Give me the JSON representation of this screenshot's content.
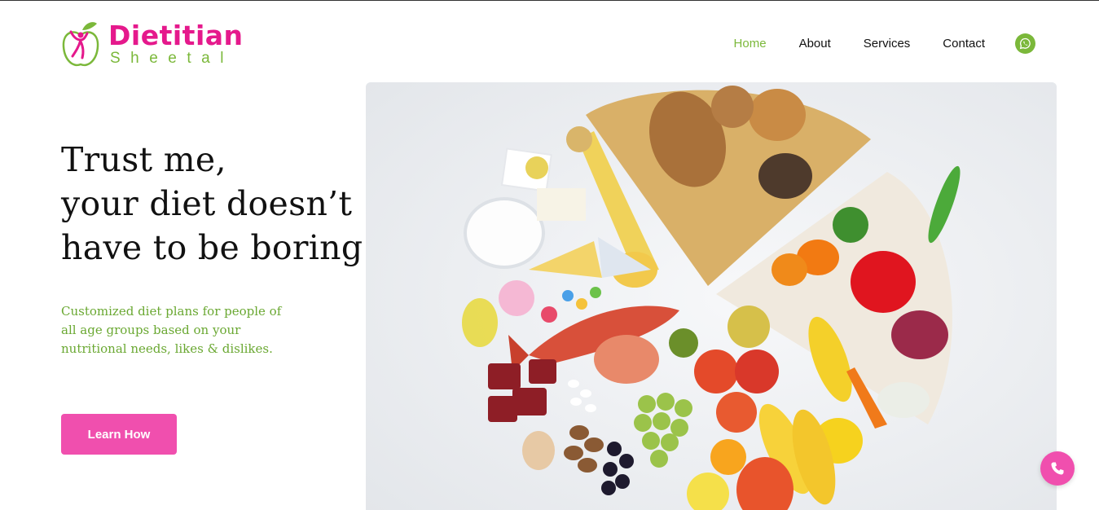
{
  "brand": {
    "title": "Dietitian",
    "subtitle": "Sheetal",
    "primary_color": "#e5198c",
    "accent_color": "#7bb83a"
  },
  "nav": {
    "items": [
      {
        "label": "Home",
        "active": true
      },
      {
        "label": "About",
        "active": false
      },
      {
        "label": "Services",
        "active": false
      },
      {
        "label": "Contact",
        "active": false
      }
    ],
    "whatsapp_icon": "whatsapp-icon"
  },
  "hero": {
    "headline": [
      "Trust me,",
      "your diet doesn’t",
      "have to be boring."
    ],
    "tagline": "Customized diet plans for people of all age groups based on your nutritional needs, likes & dislikes.",
    "cta_label": "Learn How",
    "image_icon": "food-platter-photo"
  },
  "floating": {
    "call_icon": "phone-icon",
    "call_color": "#f04fae"
  }
}
